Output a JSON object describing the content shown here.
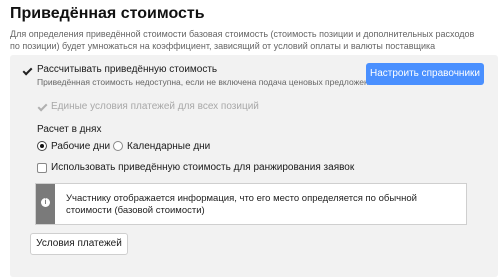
{
  "header": {
    "title": "Приведённая стоимость",
    "description": "Для определения приведённой стоимости базовая стоимость (стоимость позиции и дополнительных расходов по позиции) будет умножаться на коэффициент, зависящий от условий оплаты и валюты поставщика"
  },
  "settings": {
    "calc_reduced": {
      "label": "Рассчитывать приведённую стоимость",
      "hint": "Приведённая стоимость недоступна, если не включена подача ценовых предложений",
      "checked": true
    },
    "configure_button": "Настроить справочники",
    "uniform_terms": {
      "label": "Единые условия платежей для всех позиций",
      "checked": true,
      "disabled": true
    },
    "days_calc": {
      "label": "Расчет в днях",
      "options": [
        {
          "label": "Рабочие дни",
          "selected": true
        },
        {
          "label": "Календарные дни",
          "selected": false
        }
      ]
    },
    "use_for_ranking": {
      "label": "Использовать приведённую стоимость для ранжирования заявок",
      "checked": false
    },
    "info_message": "Участнику отображается информация, что его место определяется по обычной стоимости (базовой стоимости)",
    "payment_terms_button": "Условия платежей"
  },
  "colors": {
    "accent": "#4a90ff",
    "panel_bg": "#f2f2f2",
    "info_side": "#7a7a7a"
  }
}
